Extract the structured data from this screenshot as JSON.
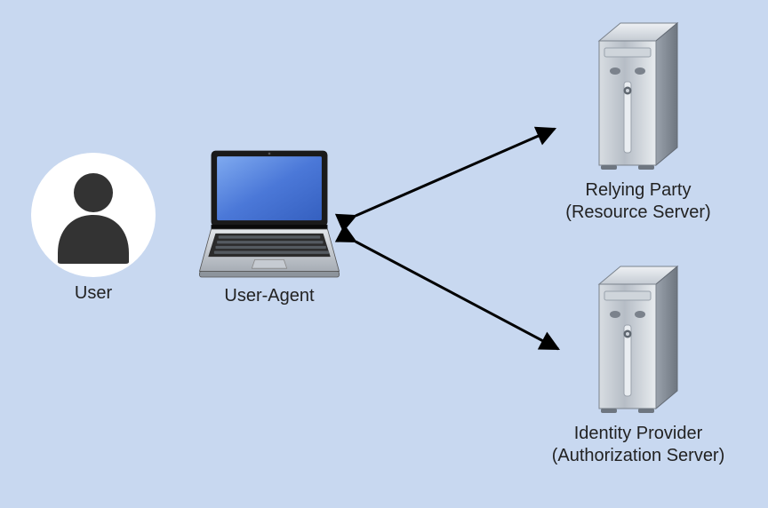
{
  "diagram": {
    "background": "#c8d8f0",
    "nodes": {
      "user": {
        "label": "User"
      },
      "user_agent": {
        "label": "User-Agent"
      },
      "relying_party": {
        "label_line1": "Relying Party",
        "label_line2": "(Resource Server)"
      },
      "identity_provider": {
        "label_line1": "Identity Provider",
        "label_line2": "(Authorization Server)"
      }
    },
    "icons": {
      "user": "person-icon",
      "user_agent": "laptop-icon",
      "relying_party": "server-icon",
      "identity_provider": "server-icon"
    },
    "edges": [
      {
        "from": "user_agent",
        "to": "relying_party",
        "bidirectional": true
      },
      {
        "from": "user_agent",
        "to": "identity_provider",
        "bidirectional": true
      }
    ]
  }
}
